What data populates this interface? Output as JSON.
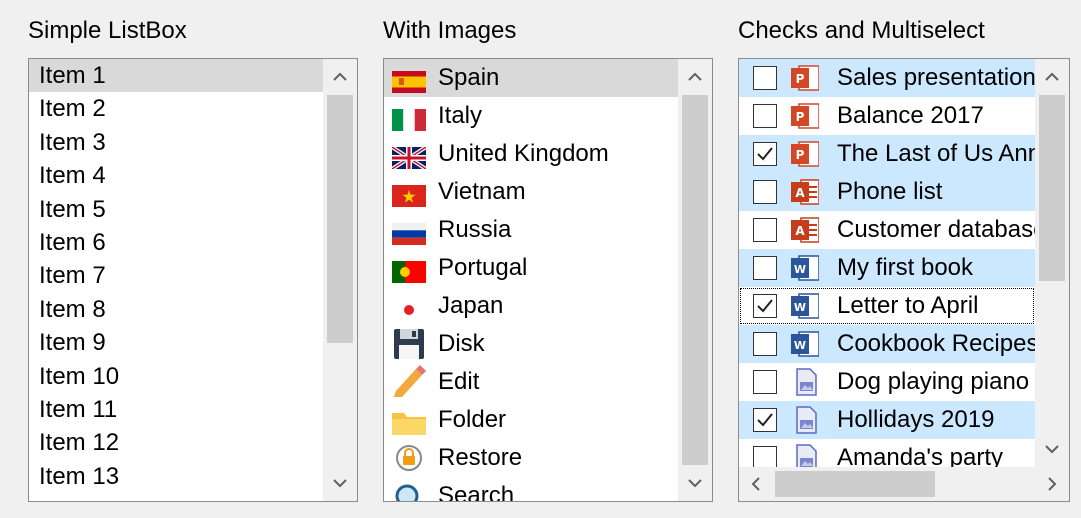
{
  "groups": {
    "simple": {
      "title": "Simple ListBox"
    },
    "images": {
      "title": "With Images"
    },
    "checks": {
      "title": "Checks and Multiselect"
    }
  },
  "simple_list": {
    "items": [
      "Item 1",
      "Item 2",
      "Item 3",
      "Item 4",
      "Item 5",
      "Item 6",
      "Item 7",
      "Item 8",
      "Item 9",
      "Item 10",
      "Item 11",
      "Item 12",
      "Item 13"
    ],
    "selected_index": 0
  },
  "image_list": {
    "items": [
      {
        "label": "Spain",
        "icon": "spain-flag-icon"
      },
      {
        "label": "Italy",
        "icon": "italy-flag-icon"
      },
      {
        "label": "United Kingdom",
        "icon": "uk-flag-icon"
      },
      {
        "label": "Vietnam",
        "icon": "vietnam-flag-icon"
      },
      {
        "label": "Russia",
        "icon": "russia-flag-icon"
      },
      {
        "label": "Portugal",
        "icon": "portugal-flag-icon"
      },
      {
        "label": "Japan",
        "icon": "japan-flag-icon"
      },
      {
        "label": "Disk",
        "icon": "disk-icon"
      },
      {
        "label": "Edit",
        "icon": "pencil-icon"
      },
      {
        "label": "Folder",
        "icon": "folder-icon"
      },
      {
        "label": "Restore",
        "icon": "restore-icon"
      },
      {
        "label": "Search",
        "icon": "search-icon"
      }
    ],
    "selected_index": 0
  },
  "check_list": {
    "items": [
      {
        "label": "Sales presentation",
        "icon": "powerpoint-icon",
        "checked": false,
        "selected": true
      },
      {
        "label": "Balance 2017",
        "icon": "powerpoint-icon",
        "checked": false,
        "selected": false
      },
      {
        "label": "The Last of Us Anniversary",
        "icon": "powerpoint-icon",
        "checked": true,
        "selected": true
      },
      {
        "label": "Phone list",
        "icon": "access-icon",
        "checked": false,
        "selected": true
      },
      {
        "label": "Customer database",
        "icon": "access-icon",
        "checked": false,
        "selected": false
      },
      {
        "label": "My first book",
        "icon": "word-icon",
        "checked": false,
        "selected": true
      },
      {
        "label": "Letter to April",
        "icon": "word-icon",
        "checked": true,
        "selected": false,
        "focused": true
      },
      {
        "label": "Cookbook Recipes",
        "icon": "word-icon",
        "checked": false,
        "selected": true
      },
      {
        "label": "Dog playing piano",
        "icon": "image-file-icon",
        "checked": false,
        "selected": false
      },
      {
        "label": "Hollidays 2019",
        "icon": "image-file-icon",
        "checked": true,
        "selected": true
      },
      {
        "label": "Amanda's party",
        "icon": "image-file-icon",
        "checked": false,
        "selected": false
      }
    ]
  },
  "colors": {
    "selection_gray": "#d9d9d9",
    "multi_selection_blue": "#cce8ff",
    "powerpoint": "#d24726",
    "word": "#2b579a",
    "access": "#c43e1c"
  }
}
